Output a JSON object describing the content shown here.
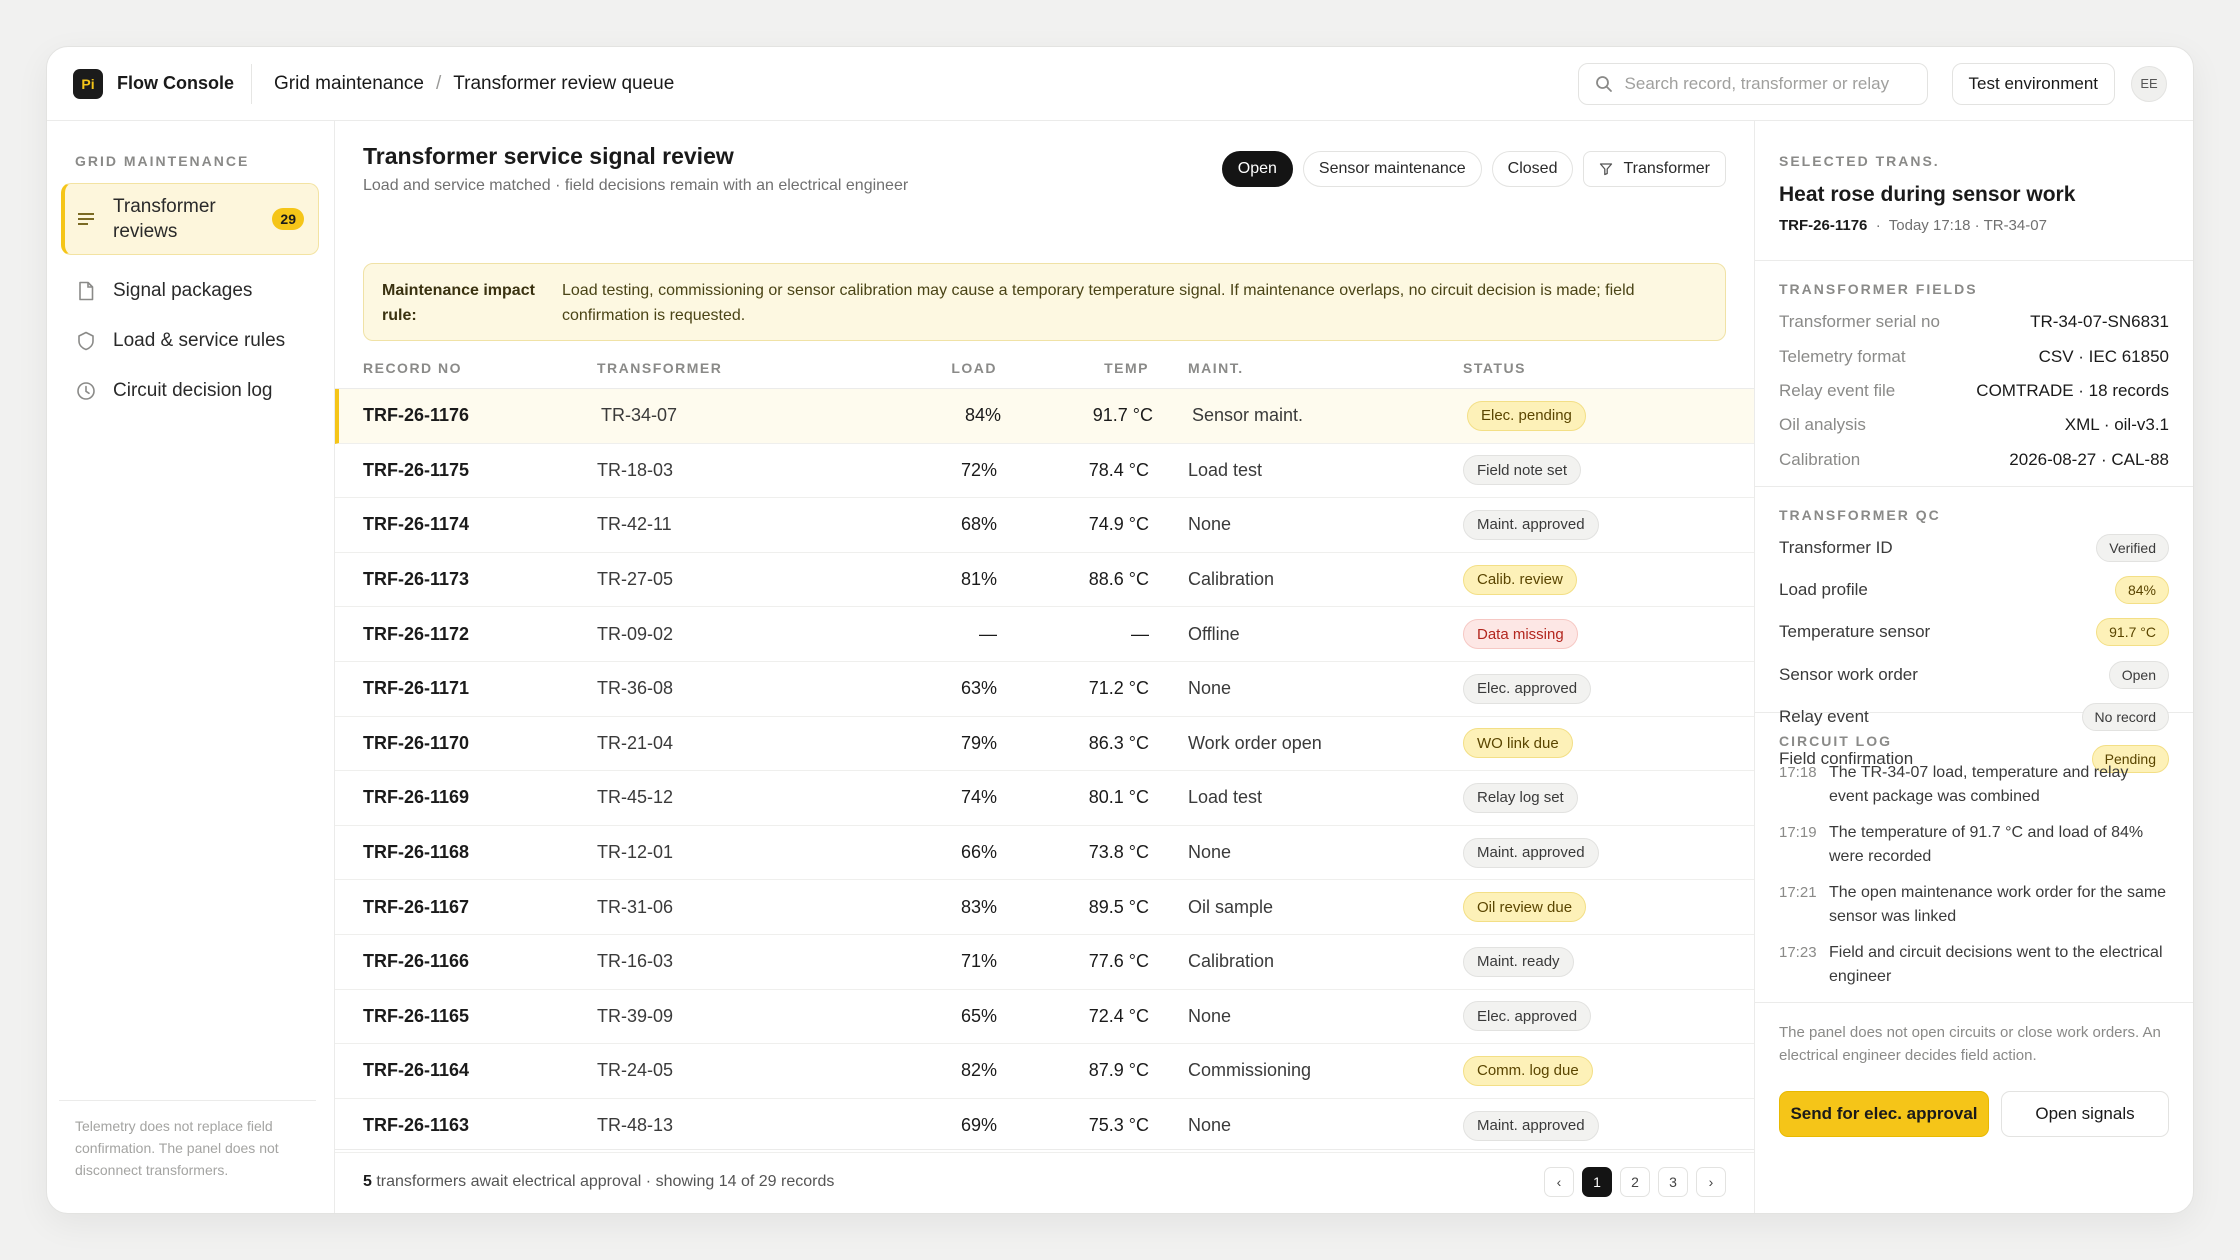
{
  "app": {
    "logo_text": "Pi",
    "name": "Flow Console"
  },
  "breadcrumb": [
    "Grid maintenance",
    "Transformer review queue"
  ],
  "breadcrumb_sep": "/",
  "search": {
    "placeholder": "Search record, transformer or relay"
  },
  "env_label": "Test environment",
  "user_initials": "EE",
  "sidebar": {
    "heading": "GRID MAINTENANCE",
    "items": [
      {
        "label": "Transformer reviews",
        "icon": "list-icon",
        "count": "29",
        "active": true
      },
      {
        "label": "Signal packages",
        "icon": "document-icon"
      },
      {
        "label": "Load & service rules",
        "icon": "shield-icon"
      },
      {
        "label": "Circuit decision log",
        "icon": "clock-icon"
      }
    ],
    "footer": "Telemetry does not replace field confirmation. The panel does not disconnect transformers."
  },
  "main": {
    "title": "Transformer service signal review",
    "subtitle": "Load and service matched · field decisions remain with an electrical engineer",
    "filters": [
      "Open",
      "Sensor maintenance",
      "Closed",
      "Transformer"
    ],
    "notice": {
      "label": "Maintenance impact rule:",
      "text": "Load testing, commissioning or sensor calibration may cause a temporary temperature signal. If maintenance overlaps, no circuit decision is made; field confirmation is requested."
    },
    "columns": [
      "RECORD NO",
      "TRANSFORMER",
      "LOAD",
      "TEMP",
      "MAINT.",
      "STATUS"
    ],
    "rows": [
      {
        "id": "TRF-26-1176",
        "tr": "TR-34-07",
        "load": "84%",
        "temp": "91.7 °C",
        "maint": "Sensor maint.",
        "status": "Elec. pending",
        "tone": "amber"
      },
      {
        "id": "TRF-26-1175",
        "tr": "TR-18-03",
        "load": "72%",
        "temp": "78.4 °C",
        "maint": "Load test",
        "status": "Field note set",
        "tone": "grey"
      },
      {
        "id": "TRF-26-1174",
        "tr": "TR-42-11",
        "load": "68%",
        "temp": "74.9 °C",
        "maint": "None",
        "status": "Maint. approved",
        "tone": "grey"
      },
      {
        "id": "TRF-26-1173",
        "tr": "TR-27-05",
        "load": "81%",
        "temp": "88.6 °C",
        "maint": "Calibration",
        "status": "Calib. review",
        "tone": "amber"
      },
      {
        "id": "TRF-26-1172",
        "tr": "TR-09-02",
        "load": "—",
        "temp": "—",
        "maint": "Offline",
        "status": "Data missing",
        "tone": "red"
      },
      {
        "id": "TRF-26-1171",
        "tr": "TR-36-08",
        "load": "63%",
        "temp": "71.2 °C",
        "maint": "None",
        "status": "Elec. approved",
        "tone": "grey"
      },
      {
        "id": "TRF-26-1170",
        "tr": "TR-21-04",
        "load": "79%",
        "temp": "86.3 °C",
        "maint": "Work order open",
        "status": "WO link due",
        "tone": "amber"
      },
      {
        "id": "TRF-26-1169",
        "tr": "TR-45-12",
        "load": "74%",
        "temp": "80.1 °C",
        "maint": "Load test",
        "status": "Relay log set",
        "tone": "grey"
      },
      {
        "id": "TRF-26-1168",
        "tr": "TR-12-01",
        "load": "66%",
        "temp": "73.8 °C",
        "maint": "None",
        "status": "Maint. approved",
        "tone": "grey"
      },
      {
        "id": "TRF-26-1167",
        "tr": "TR-31-06",
        "load": "83%",
        "temp": "89.5 °C",
        "maint": "Oil sample",
        "status": "Oil review due",
        "tone": "amber"
      },
      {
        "id": "TRF-26-1166",
        "tr": "TR-16-03",
        "load": "71%",
        "temp": "77.6 °C",
        "maint": "Calibration",
        "status": "Maint. ready",
        "tone": "grey"
      },
      {
        "id": "TRF-26-1165",
        "tr": "TR-39-09",
        "load": "65%",
        "temp": "72.4 °C",
        "maint": "None",
        "status": "Elec. approved",
        "tone": "grey"
      },
      {
        "id": "TRF-26-1164",
        "tr": "TR-24-05",
        "load": "82%",
        "temp": "87.9 °C",
        "maint": "Commissioning",
        "status": "Comm. log due",
        "tone": "amber"
      },
      {
        "id": "TRF-26-1163",
        "tr": "TR-48-13",
        "load": "69%",
        "temp": "75.3 °C",
        "maint": "None",
        "status": "Maint. approved",
        "tone": "grey"
      }
    ],
    "footer": {
      "count": "5",
      "text": " transformers await electrical approval · showing 14 of 29 records"
    },
    "pager": [
      "‹",
      "1",
      "2",
      "3",
      "›"
    ]
  },
  "panel": {
    "selected_heading": "SELECTED TRANS.",
    "selected_title": "Heat rose during sensor work",
    "selected_id": "TRF-26-1176",
    "selected_meta": "Today 17:18 · TR-34-07",
    "fields_heading": "TRANSFORMER FIELDS",
    "fields": [
      {
        "k": "Transformer serial no",
        "v": "TR-34-07-SN6831"
      },
      {
        "k": "Telemetry format",
        "v": "CSV · IEC 61850"
      },
      {
        "k": "Relay event file",
        "v": "COMTRADE · 18 records"
      },
      {
        "k": "Oil analysis",
        "v": "XML · oil-v3.1"
      },
      {
        "k": "Calibration",
        "v": "2026-08-27 · CAL-88"
      }
    ],
    "qc_heading": "TRANSFORMER QC",
    "qc": [
      {
        "k": "Transformer ID",
        "v": "Verified",
        "tone": "grey"
      },
      {
        "k": "Load profile",
        "v": "84%",
        "tone": "amber"
      },
      {
        "k": "Temperature sensor",
        "v": "91.7 °C",
        "tone": "amber"
      },
      {
        "k": "Sensor work order",
        "v": "Open",
        "tone": "grey"
      },
      {
        "k": "Relay event",
        "v": "No record",
        "tone": "grey"
      },
      {
        "k": "Field confirmation",
        "v": "Pending",
        "tone": "amber"
      }
    ],
    "log_heading": "CIRCUIT LOG",
    "log": [
      {
        "t": "17:18",
        "m": "The TR-34-07 load, temperature and relay event package was combined"
      },
      {
        "t": "17:19",
        "m": "The temperature of 91.7 °C and load of 84% were recorded"
      },
      {
        "t": "17:21",
        "m": "The open maintenance work order for the same sensor was linked"
      },
      {
        "t": "17:23",
        "m": "Field and circuit decisions went to the electrical engineer"
      }
    ],
    "note": "The panel does not open circuits or close work orders. An electrical engineer decides field action.",
    "primary_btn": "Send for elec. approval",
    "secondary_btn": "Open signals"
  }
}
